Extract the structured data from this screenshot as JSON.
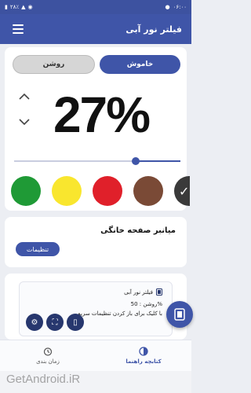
{
  "status_bar": {
    "time": "۰۶:۰۰",
    "battery": "۲۸٪"
  },
  "app_bar": {
    "title": "فیلتر نور آبی"
  },
  "toggle": {
    "off_label": "روشن",
    "on_label": "خاموش"
  },
  "intensity": {
    "value_text": "27%",
    "value": 27,
    "slider_fraction": 0.27
  },
  "colors": {
    "swatches": [
      "#1f9a36",
      "#f9e62e",
      "#e0202a",
      "#7a4a36",
      "#3a3a3a"
    ],
    "selected": "#3a3a3a"
  },
  "shortcut_card": {
    "title": "میانبر صفحه خانگی",
    "button_label": "تنظیمات"
  },
  "widget_preview": {
    "title": "فیلتر نور آبی",
    "status": "روشن : 50%",
    "hint": "با کلیک برای باز کردن تنظیمات سریع"
  },
  "bottom_nav": {
    "guide_label": "کتابچه راهنما",
    "schedule_label": "زمان بندی"
  },
  "watermark": "GetAndroid.iR",
  "accent": "#3f55a8"
}
